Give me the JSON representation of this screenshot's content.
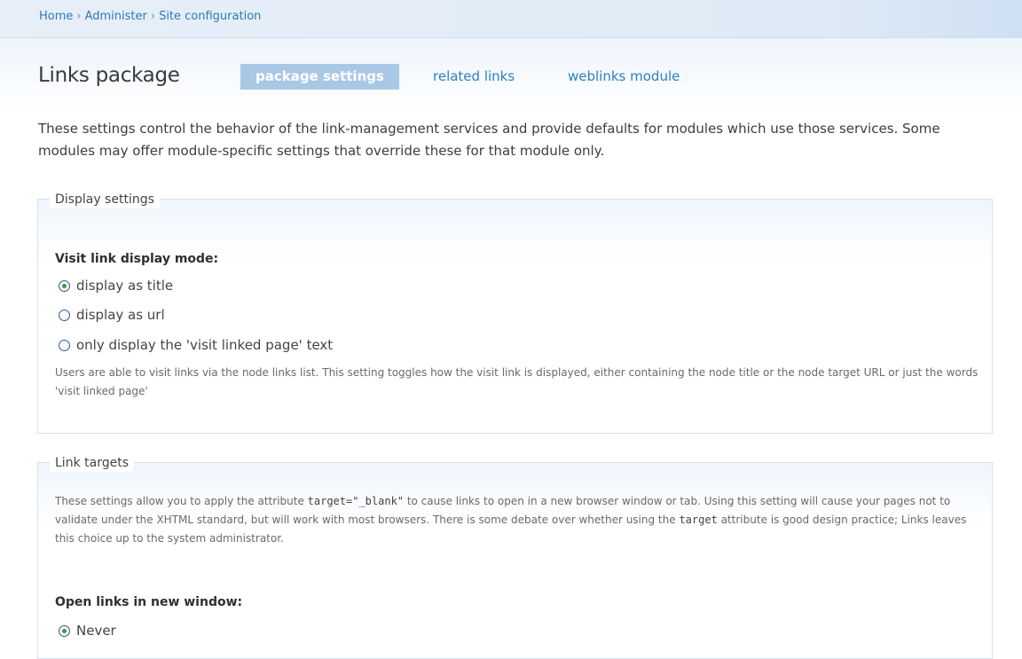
{
  "breadcrumb": {
    "items": [
      "Home",
      "Administer",
      "Site configuration"
    ],
    "separator": "›"
  },
  "page": {
    "title": "Links package",
    "intro": "These settings control the behavior of the link-management services and provide defaults for modules which use those services. Some modules may offer module-specific settings that override these for that module only."
  },
  "tabs": [
    {
      "label": "package settings",
      "active": true
    },
    {
      "label": "related links",
      "active": false
    },
    {
      "label": "weblinks module",
      "active": false
    }
  ],
  "display_settings": {
    "legend": "Display settings",
    "field_label": "Visit link display mode:",
    "options": [
      {
        "label": "display as title",
        "checked": true
      },
      {
        "label": "display as url",
        "checked": false
      },
      {
        "label": "only display the 'visit linked page' text",
        "checked": false
      }
    ],
    "help": "Users are able to visit links via the node links list. This setting toggles how the visit link is displayed, either containing the node title or the node target URL or just the words 'visit linked page'"
  },
  "link_targets": {
    "legend": "Link targets",
    "help_part1": "These settings allow you to apply the attribute ",
    "help_code1": "target=\"_blank\"",
    "help_part2": " to cause links to open in a new browser window or tab. Using this setting will cause your pages not to validate under the XHTML standard, but will work with most browsers. There is some debate over whether using the ",
    "help_code2": "target",
    "help_part3": " attribute is good design practice; Links leaves this choice up to the system administrator.",
    "field_label": "Open links in new window:",
    "options": [
      {
        "label": "Never",
        "checked": true
      }
    ]
  },
  "colors": {
    "link": "#2d7fc1",
    "active_tab_bg": "#a9c8e6",
    "radio_checked": "#3f9a3a"
  }
}
